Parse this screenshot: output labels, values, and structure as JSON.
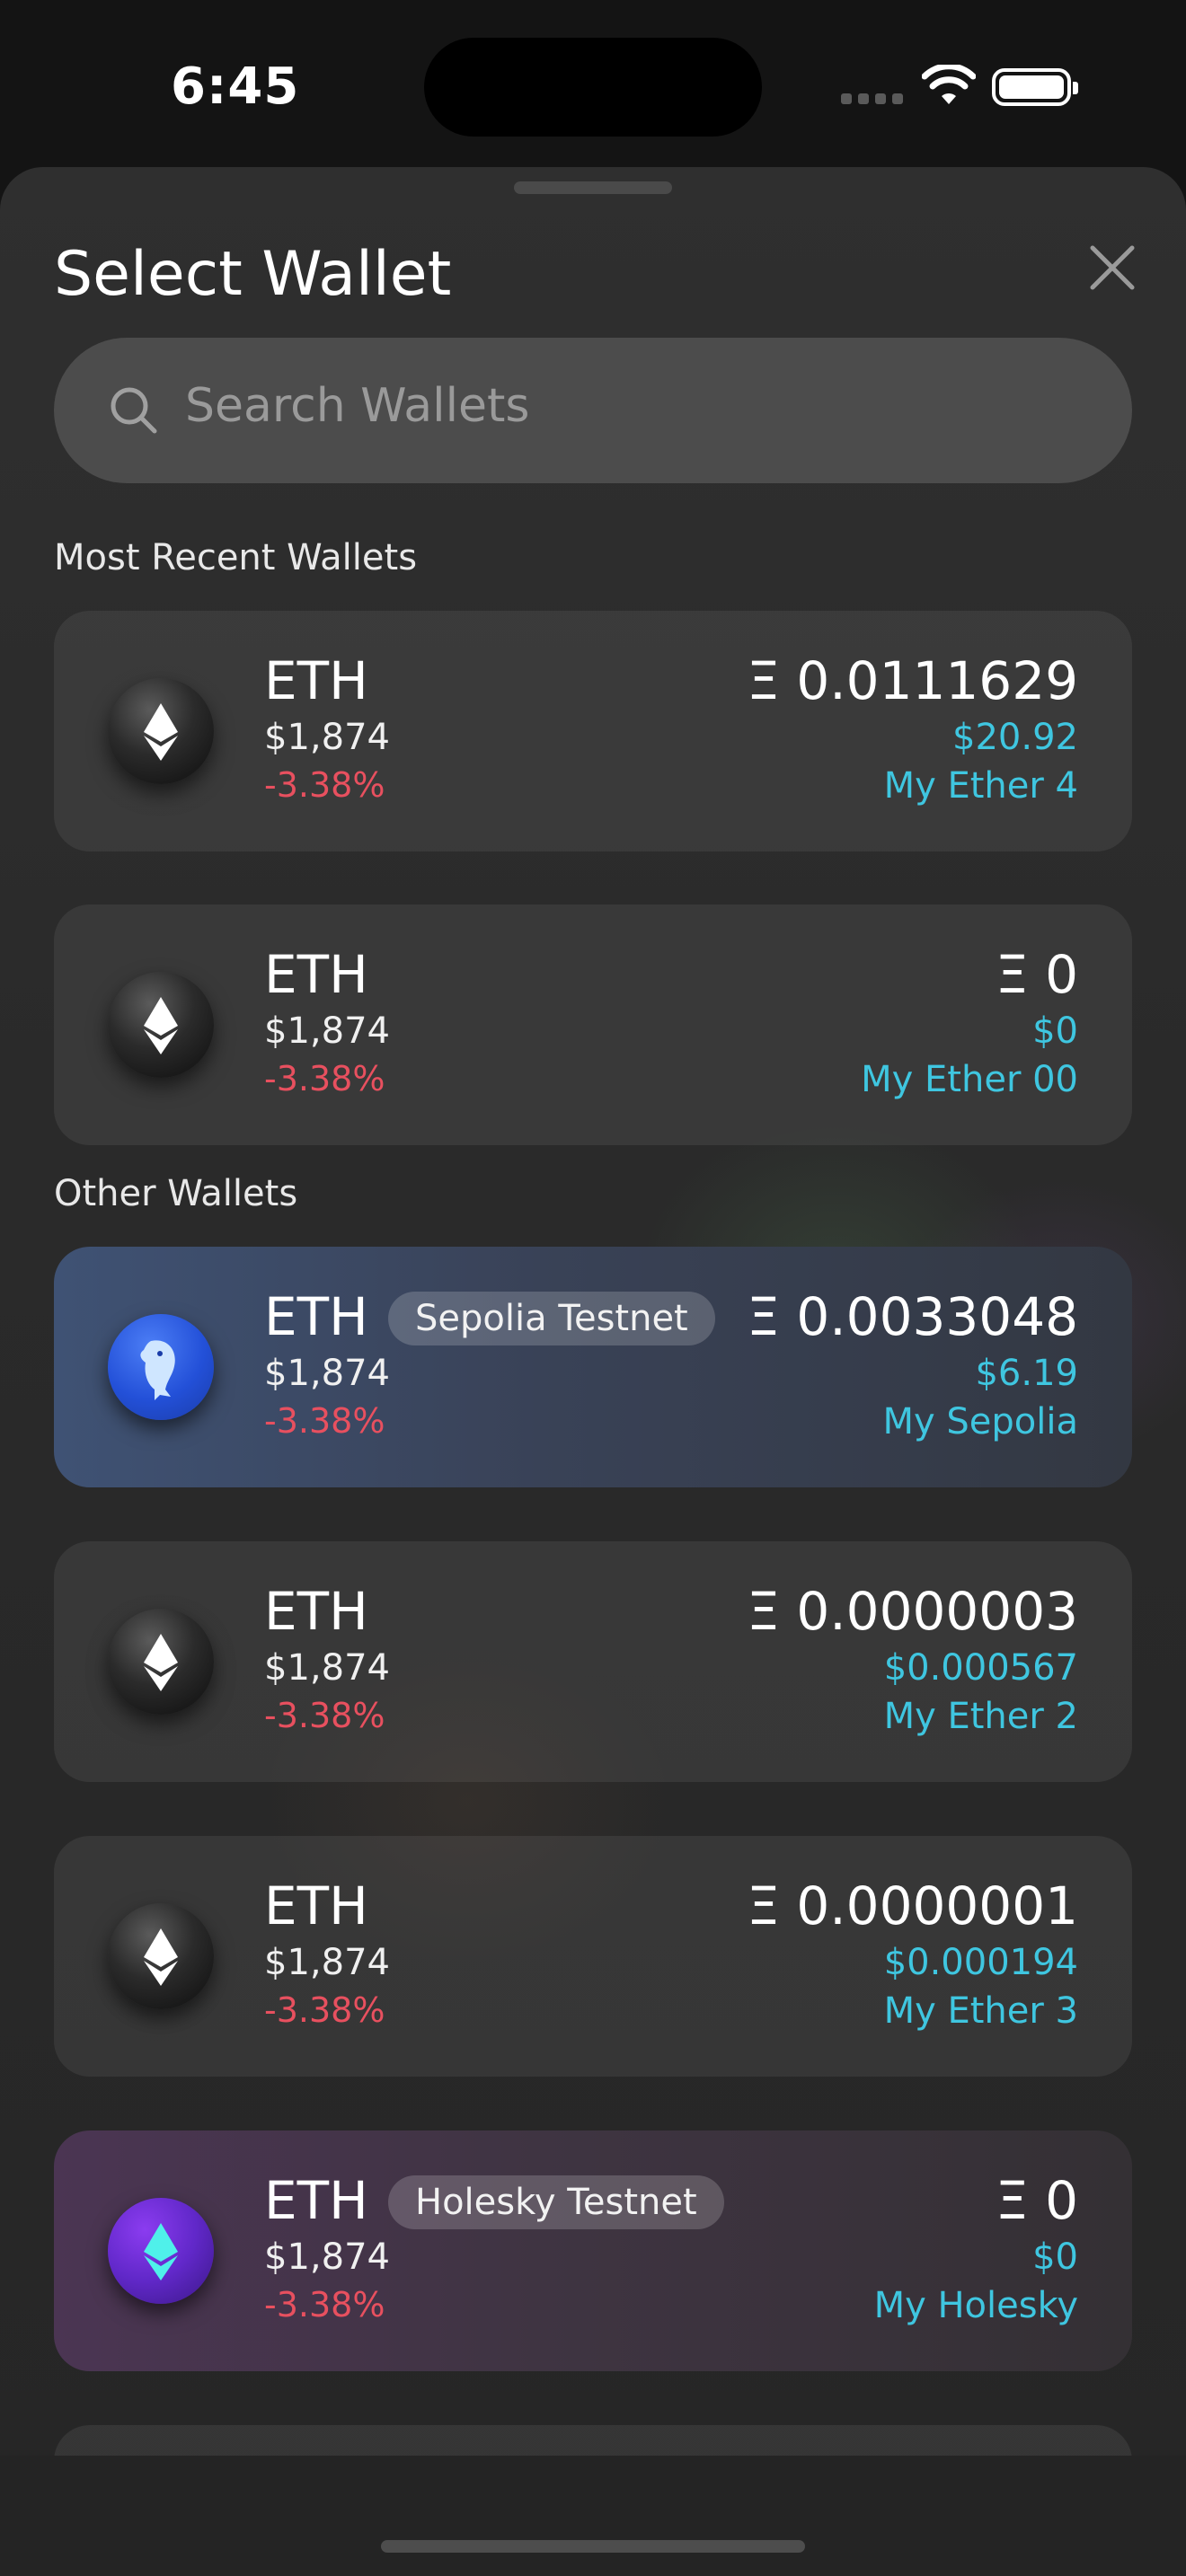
{
  "status_bar": {
    "time": "6:45"
  },
  "sheet": {
    "title": "Select Wallet",
    "search": {
      "placeholder": "Search Wallets"
    },
    "sections": {
      "recent": "Most Recent Wallets",
      "other": "Other Wallets"
    }
  },
  "wallets": [
    {
      "symbol": "ETH",
      "price": "$1,874",
      "change": "-3.38%",
      "balance": "Ξ 0.0111629",
      "fiat": "$20.92",
      "name": "My Ether 4",
      "badge": ""
    },
    {
      "symbol": "ETH",
      "price": "$1,874",
      "change": "-3.38%",
      "balance": "Ξ 0",
      "fiat": "$0",
      "name": "My Ether 00",
      "badge": ""
    },
    {
      "symbol": "ETH",
      "price": "$1,874",
      "change": "-3.38%",
      "balance": "Ξ 0.0033048",
      "fiat": "$6.19",
      "name": "My Sepolia",
      "badge": "Sepolia Testnet"
    },
    {
      "symbol": "ETH",
      "price": "$1,874",
      "change": "-3.38%",
      "balance": "Ξ 0.0000003",
      "fiat": "$0.000567",
      "name": "My Ether 2",
      "badge": ""
    },
    {
      "symbol": "ETH",
      "price": "$1,874",
      "change": "-3.38%",
      "balance": "Ξ 0.0000001",
      "fiat": "$0.000194",
      "name": "My Ether 3",
      "badge": ""
    },
    {
      "symbol": "ETH",
      "price": "$1,874",
      "change": "-3.38%",
      "balance": "Ξ 0",
      "fiat": "$0",
      "name": "My Holesky",
      "badge": "Holesky Testnet"
    }
  ],
  "colors": {
    "accent": "#3fc6e0",
    "negative": "#e8505f",
    "sheet_bg": "#2c2c2c"
  },
  "icons": [
    "search-icon",
    "close-icon",
    "eth-icon",
    "sepolia-dolphin-icon",
    "holesky-eth-icon",
    "wifi-icon",
    "battery-icon",
    "signal-icon"
  ]
}
